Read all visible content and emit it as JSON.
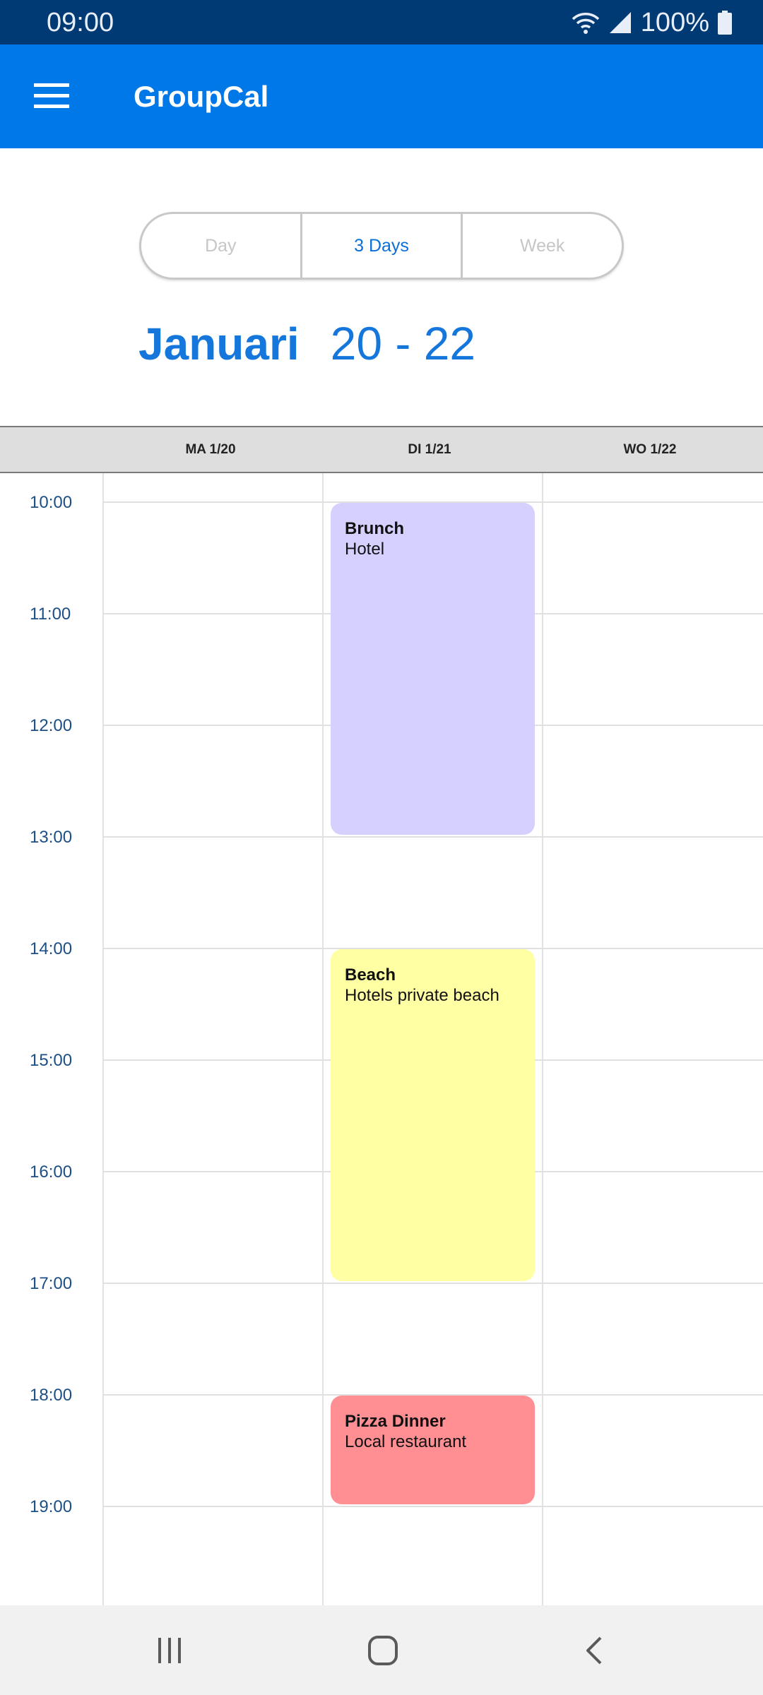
{
  "status": {
    "time": "09:00",
    "battery": "100%",
    "icons": [
      "wifi-icon",
      "signal-icon",
      "battery-icon"
    ]
  },
  "app": {
    "title": "GroupCal",
    "menu_icon": "hamburger-menu-icon"
  },
  "view_switch": {
    "options": [
      "Day",
      "3 Days",
      "Week"
    ],
    "selected": "3 Days"
  },
  "range": {
    "month": "Januari",
    "days": "20 - 22"
  },
  "calendar": {
    "days": [
      "MA 1/20",
      "DI 1/21",
      "WO 1/22"
    ],
    "hours": [
      "10:00",
      "11:00",
      "12:00",
      "13:00",
      "14:00",
      "15:00",
      "16:00",
      "17:00",
      "18:00",
      "19:00"
    ],
    "events": [
      {
        "title": "Brunch",
        "location": "Hotel",
        "day": "DI 1/21",
        "start": "10:00",
        "end": "13:00",
        "color": "#d6d0ff"
      },
      {
        "title": "Beach",
        "location": "Hotels private beach",
        "day": "DI 1/21",
        "start": "14:00",
        "end": "17:00",
        "color": "#ffffa3"
      },
      {
        "title": "Pizza Dinner",
        "location": "Local restaurant",
        "day": "DI 1/21",
        "start": "18:00",
        "end": "19:00",
        "color": "#ff8f93"
      }
    ]
  },
  "colors": {
    "status_bar": "#003a75",
    "app_bar": "#0078e8",
    "accent": "#1577dc"
  },
  "nav": {
    "icons": [
      "recent-apps-icon",
      "home-icon",
      "back-icon"
    ]
  }
}
